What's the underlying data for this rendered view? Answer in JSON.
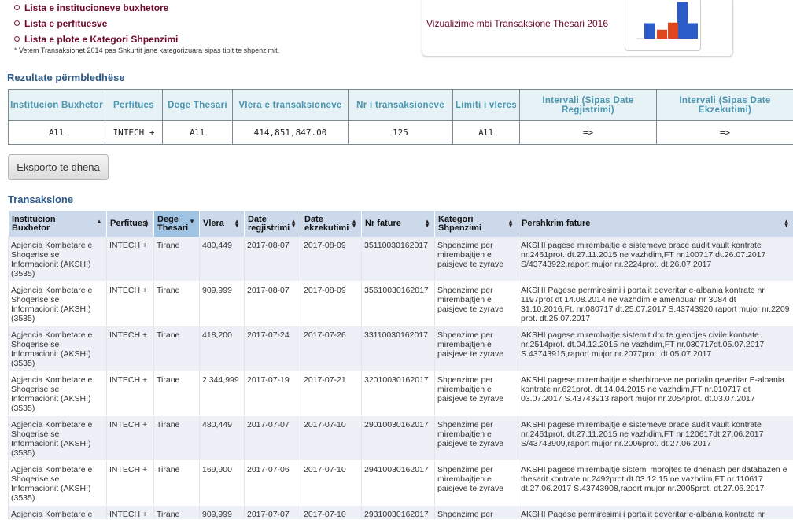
{
  "links": [
    {
      "label": "Lista e institucioneve buxhetore"
    },
    {
      "label": "Lista e perfituesve"
    },
    {
      "label": "Lista e plote e Kategori Shpenzimi"
    }
  ],
  "note": "* Vetem Transaksionet 2014 pas Shkurtit jane kategorizuara sipas tipit te shpenzimit.",
  "viz": {
    "title": "Vizualizime mbi Transaksione Thesari 2016",
    "chart_data": {
      "type": "bar",
      "series": [
        {
          "values": [
            26,
            62,
            26
          ]
        },
        {
          "values": [
            15,
            27
          ]
        }
      ],
      "colors": [
        "#2a5bc8",
        "#e0461e"
      ]
    }
  },
  "summary": {
    "title": "Rezultate përmbledhëse",
    "headers": [
      "Institucion Buxhetor",
      "Perfitues",
      "Dege Thesari",
      "Vlera e transaksioneve",
      "Nr i transaksioneve",
      "Limiti i vleres",
      "Intervali (Sipas Date Regjistrimi)",
      "Intervali (Sipas Date Ekzekutimi)"
    ],
    "row": [
      "All",
      "INTECH +",
      "All",
      "414,851,847.00",
      "125",
      "All",
      "=>",
      "=>"
    ]
  },
  "export_button": "Eksporto te dhena",
  "transactions": {
    "title": "Transaksione",
    "headers": [
      "Institucion Buxhetor",
      "Perfitues",
      "Dege Thesari",
      "Vlera",
      "Date regjistrimi",
      "Date ekzekutimi",
      "Nr fature",
      "Kategori Shpenzimi",
      "Pershkrim fature"
    ],
    "rows": [
      [
        "Agjencia Kombetare e Shoqerise se Informacionit (AKSHI) (3535)",
        "INTECH +",
        "Tirane",
        "480,449",
        "2017-08-07",
        "2017-08-09",
        "35110030162017",
        "Shpenzime per mirembajtjen e paisjeve te zyrave",
        "AKSHI pagese mirembajtje e sistemeve orace audit vault kontrate nr.2461prot. dt.27.11.2015 ne vazhdim,FT nr.100717 dt.26.07.2017 S/43743922,raport mujor nr.2224prot. dt.26.07.2017"
      ],
      [
        "Agjencia Kombetare e Shoqerise se Informacionit (AKSHI) (3535)",
        "INTECH +",
        "Tirane",
        "909,999",
        "2017-08-07",
        "2017-08-09",
        "35610030162017",
        "Shpenzime per mirembajtjen e paisjeve te zyrave",
        "AKSHI Pagese permiresimi i portalit qeveritar e-albania kontrate nr 1197prot dt 14.08.2014 ne vazhdim e amenduar nr 3084 dt 31.10.2016,Ft. nr.080717 dt.25.07.2017 S.43743920,raport mujor nr.2209 prot. dt.25.07.2017"
      ],
      [
        "Agjencia Kombetare e Shoqerise se Informacionit (AKSHI) (3535)",
        "INTECH +",
        "Tirane",
        "418,200",
        "2017-07-24",
        "2017-07-26",
        "33110030162017",
        "Shpenzime per mirembajtjen e paisjeve te zyrave",
        "AKSHI pagese mirembajtje sistemit drc te gjendjes civile kontrate nr.2514prot. dt.04.12.2015 ne vazhdim,FT nr.030717dt.05.07.2017 S.43743915,raport mujor nr.2077prot. dt.05.07.2017"
      ],
      [
        "Agjencia Kombetare e Shoqerise se Informacionit (AKSHI) (3535)",
        "INTECH +",
        "Tirane",
        "2,344,999",
        "2017-07-19",
        "2017-07-21",
        "32010030162017",
        "Shpenzime per mirembajtjen e paisjeve te zyrave",
        "AKSHI pagese mirembajtje e sherbimeve ne portalin qeveritar E-albania kontrate nr.621prot. dt.14.04.2015 ne vazhdim,FT nr.010717 dt 03.07.2017 S.43743913,raport mujor nr.2054prot. dt.03.07.2017"
      ],
      [
        "Agjencia Kombetare e Shoqerise se Informacionit (AKSHI) (3535)",
        "INTECH +",
        "Tirane",
        "480,449",
        "2017-07-07",
        "2017-07-10",
        "29010030162017",
        "Shpenzime per mirembajtjen e paisjeve te zyrave",
        "AKSHI pagese mirembajtje e sistemeve orace audit vault kontrate nr.2461prot. dt.27.11.2015 ne vazhdim,FT nr.120617dt.27.06.2017 S/43743909,raport mujor nr.2006prot. dt.27.06.2017"
      ],
      [
        "Agjencia Kombetare e Shoqerise se Informacionit (AKSHI) (3535)",
        "INTECH +",
        "Tirane",
        "169,900",
        "2017-07-06",
        "2017-07-10",
        "29410030162017",
        "Shpenzime per mirembajtjen e paisjeve te zyrave",
        "AKSHI pagese mirembajtje sistemi mbrojtes te dhenash per databazen e thesarit kontrate nr.2492prot.dt.03.12.15 ne vazhdim,FT nr.110617 dt.27.06.2017 S.43743908,raport mujor nr.2005prot. dt.27.06.2017"
      ],
      [
        "Agjencia Kombetare e",
        "INTECH +",
        "Tirane",
        "909,999",
        "2017-07-07",
        "2017-07-10",
        "29310030162017",
        "Shpenzime per",
        "AKSHI Pagese permiresimi i portalit qeveritar e-albania kontrate nr"
      ]
    ]
  }
}
